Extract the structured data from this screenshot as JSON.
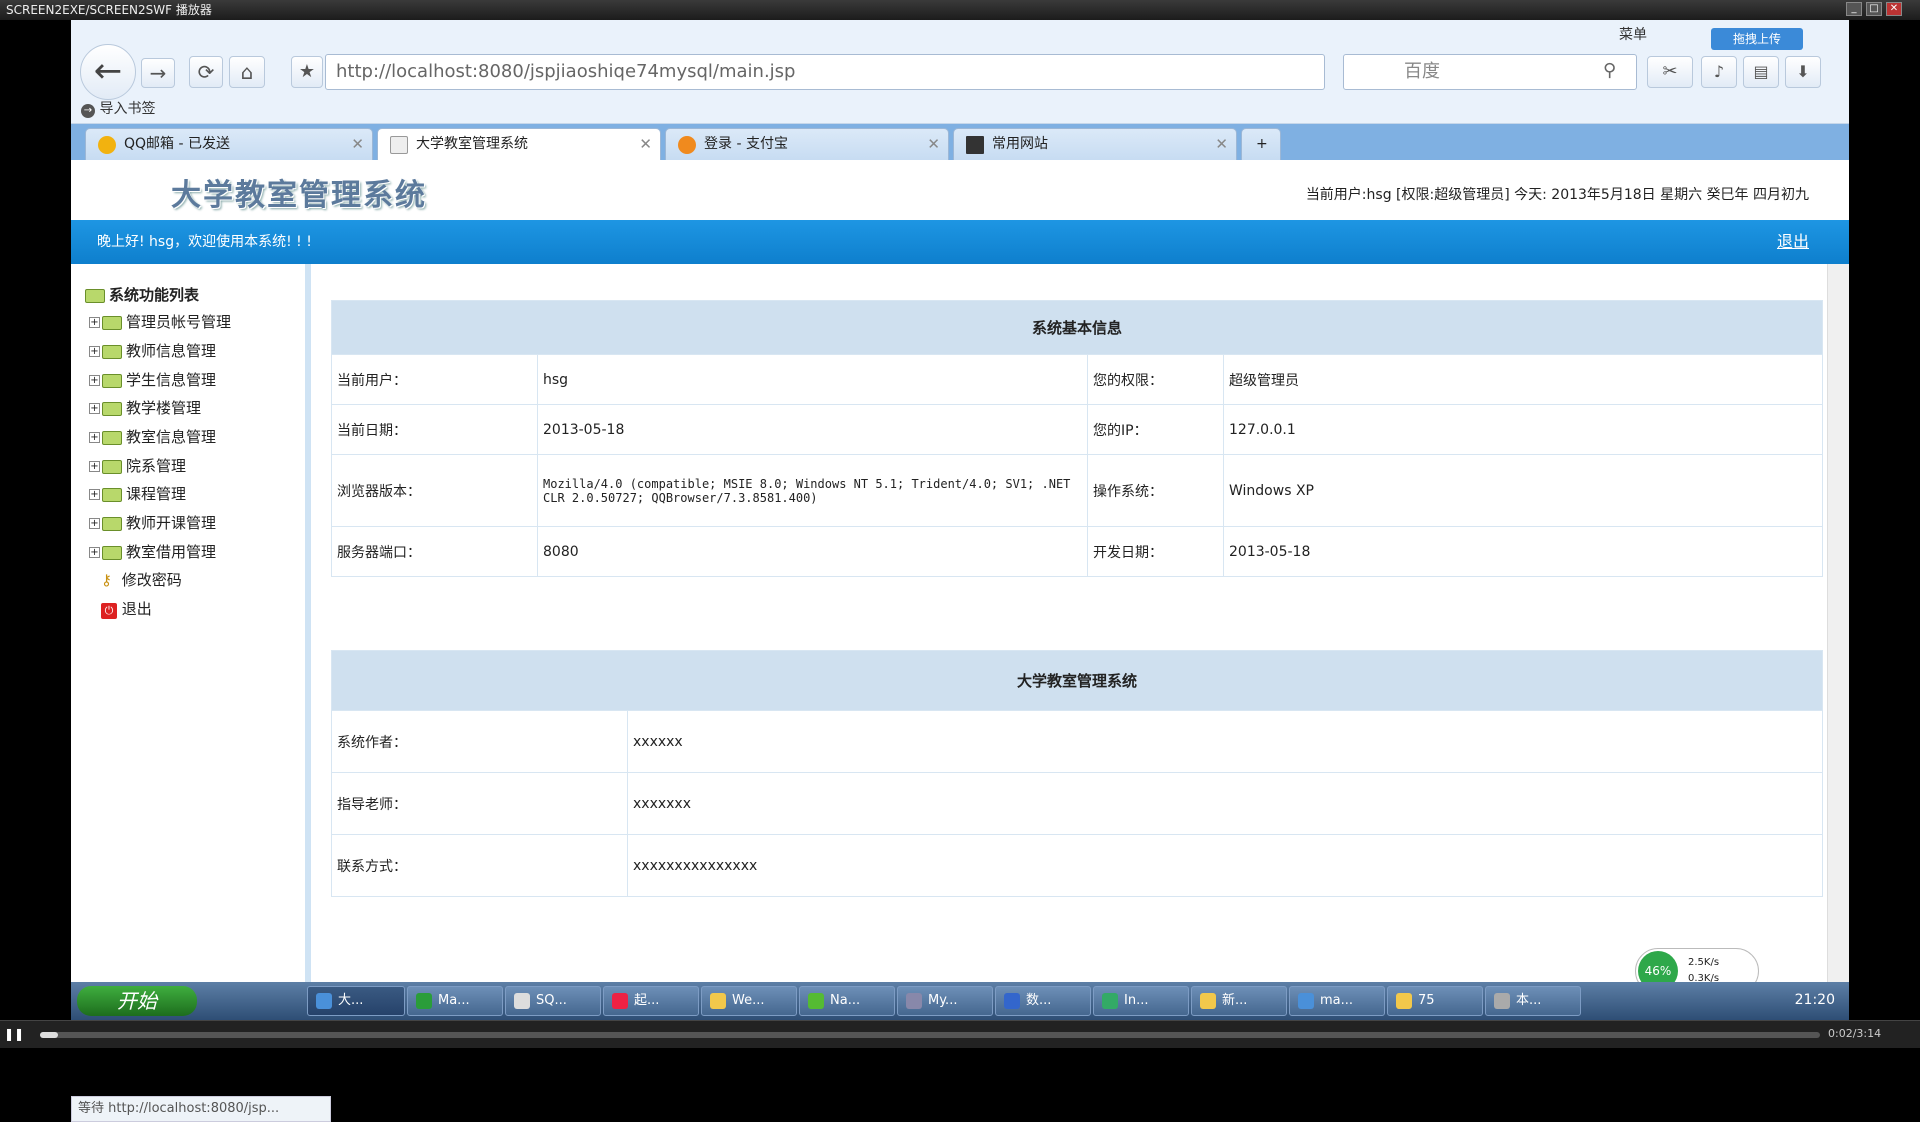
{
  "player": {
    "title": "SCREEN2EXE/SCREEN2SWF 播放器",
    "time": "0:02/3:14"
  },
  "browser": {
    "url": "http://localhost:8080/jspjiaoshiqe74mysql/main.jsp",
    "search_placeholder": "百度",
    "menu_label": "菜单",
    "upload_label": "拖拽上传",
    "bookmark_import": "导入书签",
    "tabs": [
      {
        "label": "QQ邮箱 - 已发送"
      },
      {
        "label": "大学教室管理系统"
      },
      {
        "label": "登录 - 支付宝"
      },
      {
        "label": "常用网站"
      }
    ],
    "status": "等待 http://localhost:8080/jsp..."
  },
  "site": {
    "logo": "大学教室管理系统",
    "header_info": "当前用户:hsg [权限:超级管理员] 今天: 2013年5月18日 星期六 癸巳年 四月初九",
    "welcome": "晚上好! hsg，欢迎使用本系统! ! !",
    "logout": "退出",
    "tree_root": "系统功能列表",
    "menu": [
      "管理员帐号管理",
      "教师信息管理",
      "学生信息管理",
      "教学楼管理",
      "教室信息管理",
      "院系管理",
      "课程管理",
      "教师开课管理",
      "教室借用管理"
    ],
    "change_password": "修改密码",
    "exit": "退出"
  },
  "sysinfo": {
    "title": "系统基本信息",
    "user_label": "当前用户：",
    "user": "hsg",
    "perm_label": "您的权限：",
    "perm": "超级管理员",
    "date_label": "当前日期：",
    "date": "2013-05-18",
    "ip_label": "您的IP：",
    "ip": "127.0.0.1",
    "browser_label": "浏览器版本：",
    "browser": "Mozilla/4.0 (compatible; MSIE 8.0; Windows NT 5.1; Trident/4.0; SV1; .NET CLR 2.0.50727; QQBrowser/7.3.8581.400)",
    "os_label": "操作系统：",
    "os": "Windows XP",
    "port_label": "服务器端口：",
    "port": "8080",
    "devdate_label": "开发日期：",
    "devdate": "2013-05-18"
  },
  "about": {
    "title": "大学教室管理系统",
    "author_label": "系统作者：",
    "author": "xxxxxx",
    "teacher_label": "指导老师：",
    "teacher": "xxxxxxx",
    "contact_label": "联系方式：",
    "contact": "xxxxxxxxxxxxxxx"
  },
  "taskbar": {
    "start": "开始",
    "clock": "21:20",
    "net_percent": "46%",
    "net_up": "2.5K/s",
    "net_down": "0.3K/s",
    "tasks": [
      "大...",
      "Ma...",
      "SQ...",
      "起...",
      "We...",
      "Na...",
      "My...",
      "数...",
      "In...",
      "新...",
      "ma...",
      "75",
      "本..."
    ]
  }
}
